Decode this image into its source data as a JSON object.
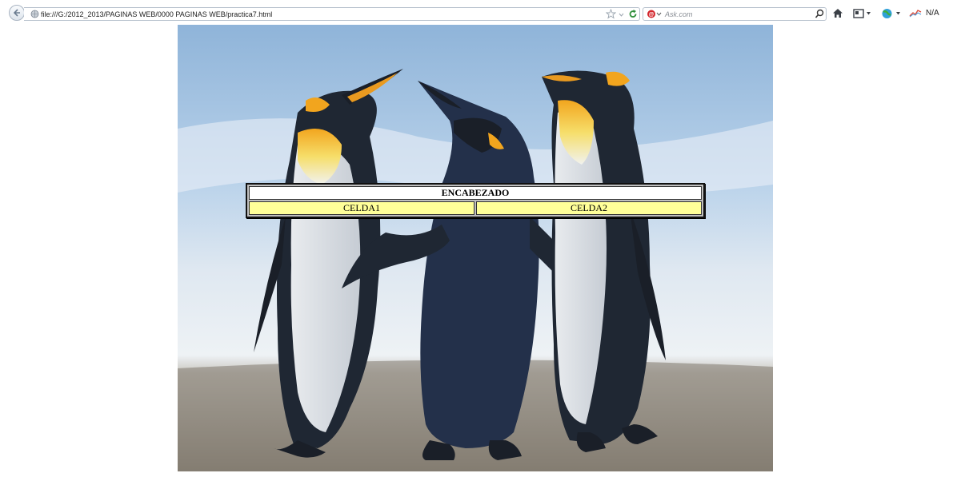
{
  "browser": {
    "url": "file:///G:/2012_2013/PAGINAS WEB/0000 PAGINAS WEB/practica7.html",
    "search_placeholder": "Ask.com",
    "addon_status": "N/A"
  },
  "page": {
    "image": {
      "alt": "penguins-image",
      "description_icon": "penguins"
    },
    "table": {
      "header": "ENCABEZADO",
      "cells": [
        "CELDA1",
        "CELDA2"
      ],
      "header_bg": "#ffffff",
      "cell_bg": "#ffff99"
    }
  },
  "colors": {
    "border": "#111111",
    "url_text": "#222222"
  }
}
